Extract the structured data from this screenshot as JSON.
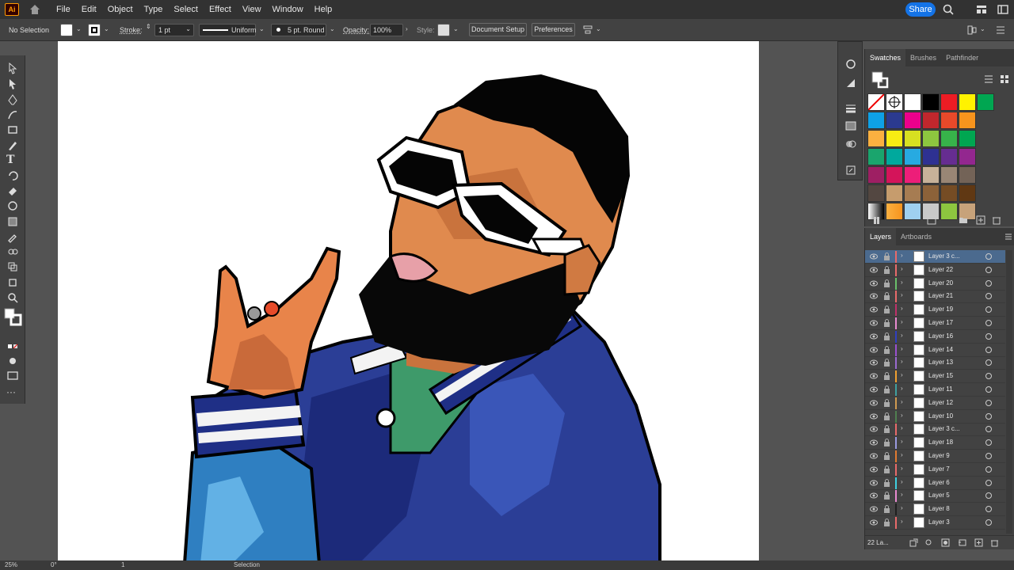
{
  "menubar": {
    "app_logo": "Ai",
    "items": [
      "File",
      "Edit",
      "Object",
      "Type",
      "Select",
      "Effect",
      "View",
      "Window",
      "Help"
    ],
    "share_label": "Share"
  },
  "controlbar": {
    "selection_label": "No Selection",
    "stroke_label": "Stroke:",
    "stroke_weight": "1 pt",
    "stroke_profile": "Uniform",
    "brush_label": "5 pt. Round",
    "opacity_label": "Opacity:",
    "opacity_value": "100%",
    "style_label": "Style:",
    "document_setup_label": "Document Setup",
    "preferences_label": "Preferences"
  },
  "swatches_panel": {
    "tabs": [
      "Swatches",
      "Brushes",
      "Pathfinder"
    ],
    "colors": [
      "#0ea1e6",
      "#2b3a8f",
      "#ec008c",
      "#c1272d",
      "#e8492a",
      "#f7941d",
      "#fbb040",
      "#f7ec13",
      "#d7e021",
      "#8dc63f",
      "#37b34a",
      "#00a651",
      "#1aa56d",
      "#00a99d",
      "#27aae1",
      "#2e3192",
      "#662d91",
      "#93278f",
      "#9e1f63",
      "#d4145a",
      "#ed1e79",
      "#c7b299",
      "#998675",
      "#736357",
      "#534741",
      "#c69c6d",
      "#a67c52",
      "#8c6239",
      "#754c24",
      "#603813"
    ]
  },
  "layers_panel": {
    "tabs": [
      "Layers",
      "Artboards"
    ],
    "footer_count": "22 La...",
    "layers": [
      {
        "name": "Layer 3 c...",
        "color": "#e86a6a",
        "selected": true
      },
      {
        "name": "Layer 22",
        "color": "#e86a6a",
        "selected": false
      },
      {
        "name": "Layer 20",
        "color": "#6ac06a",
        "selected": false
      },
      {
        "name": "Layer 21",
        "color": "#e86a6a",
        "selected": false
      },
      {
        "name": "Layer 19",
        "color": "#c0306a",
        "selected": false
      },
      {
        "name": "Layer 17",
        "color": "#e88ad0",
        "selected": false
      },
      {
        "name": "Layer 16",
        "color": "#3040c0",
        "selected": false
      },
      {
        "name": "Layer 14",
        "color": "#9a50d0",
        "selected": false
      },
      {
        "name": "Layer 13",
        "color": "#9a6ad0",
        "selected": false
      },
      {
        "name": "Layer 15",
        "color": "#f0a030",
        "selected": false
      },
      {
        "name": "Layer 11",
        "color": "#40a0a0",
        "selected": false
      },
      {
        "name": "Layer 12",
        "color": "#d09a50",
        "selected": false
      },
      {
        "name": "Layer 10",
        "color": "#508050",
        "selected": false
      },
      {
        "name": "Layer 3 c...",
        "color": "#e86a6a",
        "selected": false
      },
      {
        "name": "Layer 18",
        "color": "#9a9ae0",
        "selected": false
      },
      {
        "name": "Layer 9",
        "color": "#e07a30",
        "selected": false
      },
      {
        "name": "Layer 7",
        "color": "#e86a6a",
        "selected": false
      },
      {
        "name": "Layer 6",
        "color": "#40d0e0",
        "selected": false
      },
      {
        "name": "Layer 5",
        "color": "#e88ad0",
        "selected": false
      },
      {
        "name": "Layer 8",
        "color": "#202020",
        "selected": false
      },
      {
        "name": "Layer 3",
        "color": "#e86a6a",
        "selected": false
      }
    ]
  },
  "statusbar": {
    "zoom": "25%",
    "rotation": "0°",
    "artboard_number": "1",
    "tool_name": "Selection"
  }
}
